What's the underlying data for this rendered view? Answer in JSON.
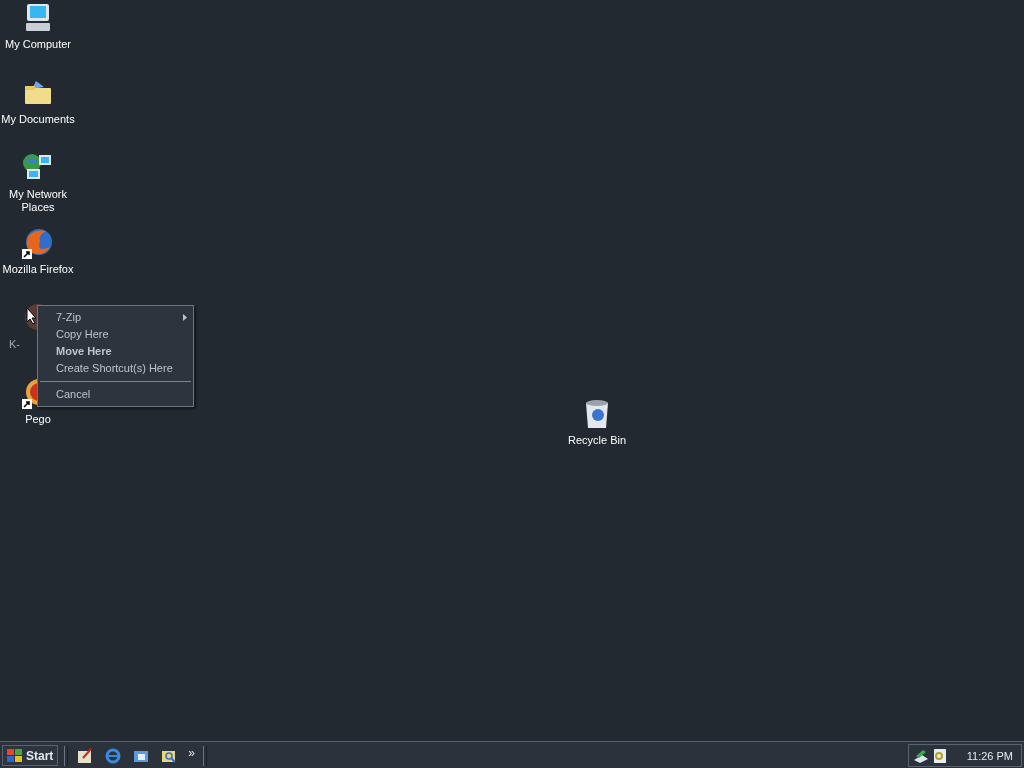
{
  "desktop_icons": [
    {
      "label": "My Computer",
      "shortcut": false,
      "dimmed": false
    },
    {
      "label": "My Documents",
      "shortcut": false,
      "dimmed": false
    },
    {
      "label": "My Network Places",
      "shortcut": false,
      "dimmed": false
    },
    {
      "label": "Mozilla Firefox",
      "shortcut": true,
      "dimmed": false
    },
    {
      "label": "K-",
      "shortcut": false,
      "dimmed": true
    },
    {
      "label": "Pego",
      "shortcut": true,
      "dimmed": false
    }
  ],
  "recycle_bin": {
    "label": "Recycle Bin"
  },
  "context_menu": [
    {
      "kind": "submenu",
      "label": "7-Zip",
      "default": false
    },
    {
      "kind": "item",
      "label": "Copy Here",
      "default": false
    },
    {
      "kind": "item",
      "label": "Move Here",
      "default": true
    },
    {
      "kind": "item",
      "label": "Create Shortcut(s) Here",
      "default": false
    },
    {
      "kind": "separator"
    },
    {
      "kind": "item",
      "label": "Cancel",
      "default": false
    }
  ],
  "taskbar": {
    "start": "Start",
    "quick_launch_more": "»",
    "clock": "11:26 PM"
  }
}
